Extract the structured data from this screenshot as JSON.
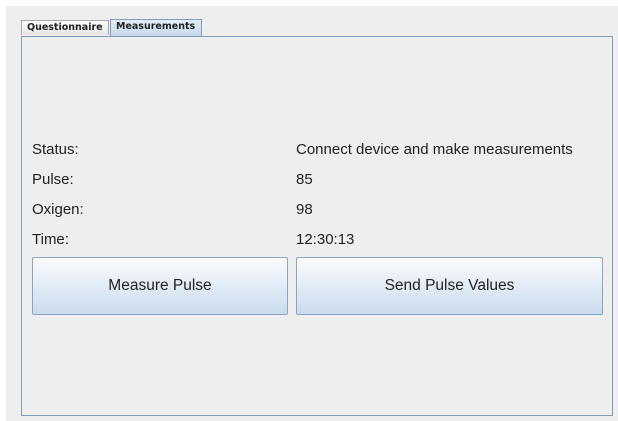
{
  "tabs": [
    {
      "label": "Questionnaire",
      "active": false
    },
    {
      "label": "Measurements",
      "active": true
    }
  ],
  "fields": {
    "status": {
      "label": "Status:",
      "value": "Connect device and make measurements"
    },
    "pulse": {
      "label": "Pulse:",
      "value": "85"
    },
    "oxygen": {
      "label": "Oxigen:",
      "value": "98"
    },
    "time": {
      "label": "Time:",
      "value": "12:30:13"
    }
  },
  "buttons": {
    "measure_pulse": "Measure Pulse",
    "send_pulse_values": "Send Pulse Values"
  },
  "colors": {
    "panel_background": "#eeeeee",
    "panel_border": "#7f9db9",
    "active_tab": "#c8d9ec",
    "button_gradient_top": "#fbfcfe",
    "button_gradient_bottom": "#c9daed"
  }
}
